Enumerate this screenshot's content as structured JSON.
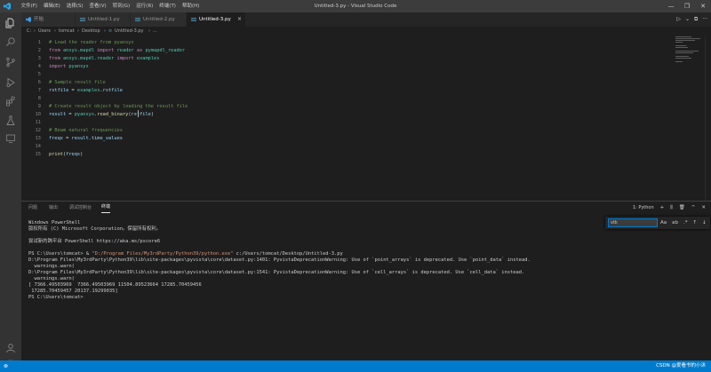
{
  "window": {
    "title": "Untitled-3.py - Visual Studio Code",
    "menu": [
      "文件(F)",
      "编辑(E)",
      "选择(S)",
      "查看(V)",
      "转到(G)",
      "运行(R)",
      "终端(T)",
      "帮助(H)"
    ],
    "controls": [
      "—",
      "❐",
      "✕"
    ]
  },
  "tabs": [
    {
      "label": "开始",
      "active": false
    },
    {
      "label": "Untitled-1.py",
      "active": false
    },
    {
      "label": "Untitled-2.py",
      "active": false
    },
    {
      "label": "Untitled-3.py",
      "active": true
    }
  ],
  "tab_close": "×",
  "editor_actions": [
    "▷",
    "⌄",
    "⧉",
    "···"
  ],
  "breadcrumb": [
    "C:",
    "Users",
    "tomcat",
    "Desktop",
    "Untitled-3.py",
    "..."
  ],
  "editor": {
    "lines": [
      {
        "n": "1",
        "parts": [
          {
            "c": "c-cm",
            "t": "# Load the reader from pyansys"
          }
        ]
      },
      {
        "n": "2",
        "parts": [
          {
            "c": "c-kw",
            "t": "from "
          },
          {
            "c": "c-mod",
            "t": "ansys.mapdl"
          },
          {
            "c": "c-kw",
            "t": " import "
          },
          {
            "c": "c-mod",
            "t": "reader"
          },
          {
            "c": "c-kw",
            "t": " as "
          },
          {
            "c": "c-mod",
            "t": "pymapdl_reader"
          }
        ]
      },
      {
        "n": "3",
        "parts": [
          {
            "c": "c-kw",
            "t": "from "
          },
          {
            "c": "c-mod",
            "t": "ansys.mapdl.reader"
          },
          {
            "c": "c-kw",
            "t": " import "
          },
          {
            "c": "c-mod",
            "t": "examples"
          }
        ]
      },
      {
        "n": "4",
        "parts": [
          {
            "c": "c-kw",
            "t": "import "
          },
          {
            "c": "c-mod",
            "t": "pyansys"
          }
        ]
      },
      {
        "n": "5",
        "parts": []
      },
      {
        "n": "6",
        "parts": [
          {
            "c": "c-cm",
            "t": "# Sample result file"
          }
        ]
      },
      {
        "n": "7",
        "parts": [
          {
            "c": "c-id",
            "t": "rstfile"
          },
          {
            "c": "c-tx",
            "t": " = "
          },
          {
            "c": "c-mod",
            "t": "examples"
          },
          {
            "c": "c-tx",
            "t": "."
          },
          {
            "c": "c-id",
            "t": "rstfile"
          }
        ]
      },
      {
        "n": "8",
        "parts": []
      },
      {
        "n": "9",
        "parts": [
          {
            "c": "c-cm",
            "t": "# Create result object by loading the result file"
          }
        ]
      },
      {
        "n": "10",
        "parts": [
          {
            "c": "c-id",
            "t": "result"
          },
          {
            "c": "c-tx",
            "t": " = "
          },
          {
            "c": "c-mod",
            "t": "pyansys"
          },
          {
            "c": "c-tx",
            "t": "."
          },
          {
            "c": "c-fn",
            "t": "read_binary"
          },
          {
            "c": "c-tx",
            "t": "("
          },
          {
            "c": "c-id",
            "t": "rstfile"
          },
          {
            "c": "c-tx",
            "t": ")"
          }
        ]
      },
      {
        "n": "11",
        "parts": []
      },
      {
        "n": "12",
        "parts": [
          {
            "c": "c-cm",
            "t": "# Beam natural frequencies"
          }
        ]
      },
      {
        "n": "13",
        "parts": [
          {
            "c": "c-id",
            "t": "freqs"
          },
          {
            "c": "c-tx",
            "t": " = "
          },
          {
            "c": "c-id",
            "t": "result"
          },
          {
            "c": "c-tx",
            "t": "."
          },
          {
            "c": "c-id",
            "t": "time_values"
          }
        ]
      },
      {
        "n": "14",
        "parts": []
      },
      {
        "n": "15",
        "parts": [
          {
            "c": "c-fn",
            "t": "print"
          },
          {
            "c": "c-tx",
            "t": "("
          },
          {
            "c": "c-id",
            "t": "freqs"
          },
          {
            "c": "c-tx",
            "t": ")"
          }
        ]
      }
    ]
  },
  "panel": {
    "tabs": [
      {
        "label": "问题",
        "active": false
      },
      {
        "label": "输出",
        "active": false
      },
      {
        "label": "调试控制台",
        "active": false
      },
      {
        "label": "终端",
        "active": true
      }
    ],
    "terminal_selector": "1: Python",
    "actions": [
      "+",
      "⫼",
      "🗑",
      "^",
      "✕"
    ],
    "find": {
      "value": "vtk",
      "buttons": [
        "Aa",
        "ab",
        ".*",
        "↑",
        "↓",
        "✕"
      ]
    },
    "terminal_lines": [
      {
        "t": "Windows PowerShell"
      },
      {
        "t": "版权所有 (C) Microsoft Corporation。保留所有权利。"
      },
      {
        "t": ""
      },
      {
        "t": "尝试新的跨平台 PowerShell https://aka.ms/pscore6"
      },
      {
        "t": ""
      },
      {
        "t": "PS C:\\Users\\tomcat> & ",
        "s": "\"D:/Program Files/My3rdParty/Python39/python.exe\"",
        "r": " c:/Users/tomcat/Desktop/Untitled-3.py"
      },
      {
        "t": "D:\\Program Files\\My3rdParty\\Python39\\lib\\site-packages\\pyvista\\core\\dataset.py:1401: PyvistaDeprecationWarning: Use of `point_arrays` is deprecated. Use `point_data` instead."
      },
      {
        "t": "  warnings.warn("
      },
      {
        "t": "D:\\Program Files\\My3rdParty\\Python39\\lib\\site-packages\\pyvista\\core\\dataset.py:1541: PyvistaDeprecationWarning: Use of `cell_arrays` is deprecated. Use `cell_data` instead."
      },
      {
        "t": "  warnings.warn("
      },
      {
        "t": "[ 7366.49503969  7366.49503969 11504.89523664 17285.70459456"
      },
      {
        "t": " 17285.70459457 20137.19299035]"
      },
      {
        "t": "PS C:\\Users\\tomcat>"
      }
    ]
  },
  "statusbar": {
    "left_icon": "⊗",
    "watermark": "CSDN @爱看书的小沐"
  }
}
